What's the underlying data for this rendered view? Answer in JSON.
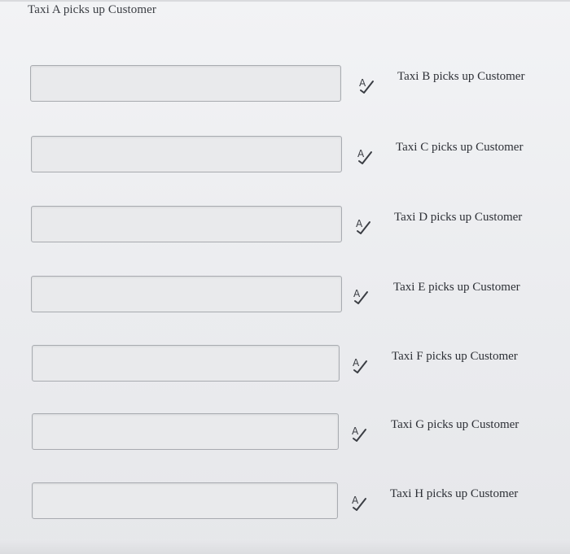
{
  "header": {
    "label": "Taxi A picks up Customer"
  },
  "rows": [
    {
      "option_label": "Taxi B picks up Customer",
      "icon": "spell-check-icon"
    },
    {
      "option_label": "Taxi C picks up Customer",
      "icon": "spell-check-icon"
    },
    {
      "option_label": "Taxi D picks up Customer",
      "icon": "spell-check-icon"
    },
    {
      "option_label": "Taxi E picks up Customer",
      "icon": "spell-check-icon"
    },
    {
      "option_label": "Taxi F picks up Customer",
      "icon": "spell-check-icon"
    },
    {
      "option_label": "Taxi G picks up Customer",
      "icon": "spell-check-icon"
    },
    {
      "option_label": "Taxi H picks up Customer",
      "icon": "spell-check-icon"
    }
  ],
  "colors": {
    "background": "#ebecef",
    "input_border": "#a8abb0",
    "text": "#2d3036"
  }
}
